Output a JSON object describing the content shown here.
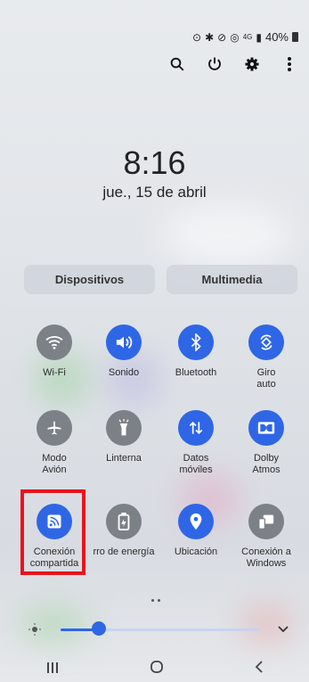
{
  "status": {
    "icons": [
      "alarm-icon",
      "bluetooth-icon",
      "no-disturb-icon",
      "hotspot-icon",
      "4g-icon",
      "signal-icon"
    ],
    "battery": "40%"
  },
  "topbar": {
    "icons": [
      "search-icon",
      "power-icon",
      "gear-icon",
      "more-icon"
    ]
  },
  "clock": {
    "time": "8:16",
    "date": "jue., 15 de abril"
  },
  "pills": {
    "devices": "Dispositivos",
    "media": "Multimedia"
  },
  "tiles": [
    {
      "label": "Wi-Fi",
      "icon": "wifi-icon",
      "state": "off"
    },
    {
      "label": "Sonido",
      "icon": "sound-icon",
      "state": "on"
    },
    {
      "label": "Bluetooth",
      "icon": "bluetooth-icon",
      "state": "on"
    },
    {
      "label": "Giro\nauto",
      "icon": "rotate-icon",
      "state": "on"
    },
    {
      "label": "Modo\nAvión",
      "icon": "airplane-icon",
      "state": "off"
    },
    {
      "label": "Linterna",
      "icon": "flashlight-icon",
      "state": "off"
    },
    {
      "label": "Datos\nmóviles",
      "icon": "data-icon",
      "state": "on"
    },
    {
      "label": "Dolby\nAtmos",
      "icon": "dolby-icon",
      "state": "on"
    },
    {
      "label": "Conexión\ncompartida",
      "icon": "hotspot-icon",
      "state": "on"
    },
    {
      "label": "rro de energía",
      "icon": "battery-saver-icon",
      "state": "off"
    },
    {
      "label": "Ubicación",
      "icon": "location-icon",
      "state": "on"
    },
    {
      "label": "Conexión a\nWindows",
      "icon": "windows-link-icon",
      "state": "off"
    }
  ],
  "brightness": {
    "level": 0.2
  },
  "colors": {
    "accent": "#2f66e6",
    "tile_off": "#7c8087",
    "highlight": "#e8141c"
  }
}
